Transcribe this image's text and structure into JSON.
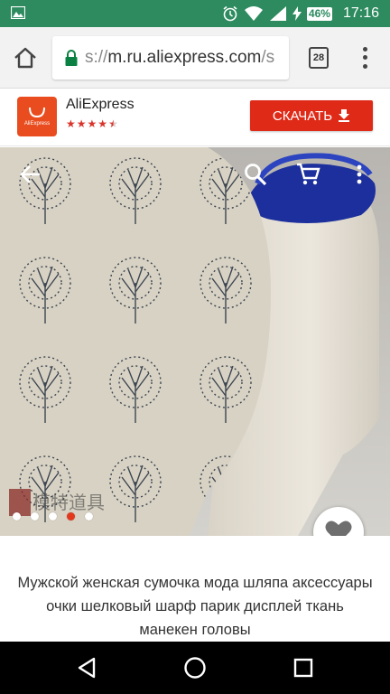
{
  "status_bar": {
    "battery_percent": "46%",
    "time": "17:16"
  },
  "browser": {
    "url_prefix": "s://",
    "url_host": "m.ru.aliexpress.com",
    "url_suffix": "/s",
    "tab_count": "28"
  },
  "app_banner": {
    "logo_text": "AliExpress",
    "app_name": "AliExpress",
    "rating_stars": 4.5,
    "download_label": "СКАЧАТЬ"
  },
  "carousel": {
    "total_slides": 5,
    "active_index": 3
  },
  "product": {
    "title": "Мужской женская сумочка мода шляпа аксессуары очки шелковый шарф парик дисплей ткань манекен головы"
  },
  "colors": {
    "status_bar": "#2d8b5f",
    "accent": "#e02a18",
    "active_dot": "#e2391d"
  },
  "icons": {
    "status_left": "image-icon",
    "alarm": "alarm-icon",
    "wifi": "wifi-icon",
    "signal": "signal-icon",
    "charging": "bolt-icon",
    "home": "home-icon",
    "lock": "lock-icon",
    "back": "back-arrow-icon",
    "search": "search-icon",
    "cart": "cart-icon",
    "more": "more-vert-icon",
    "favorite": "heart-icon"
  }
}
